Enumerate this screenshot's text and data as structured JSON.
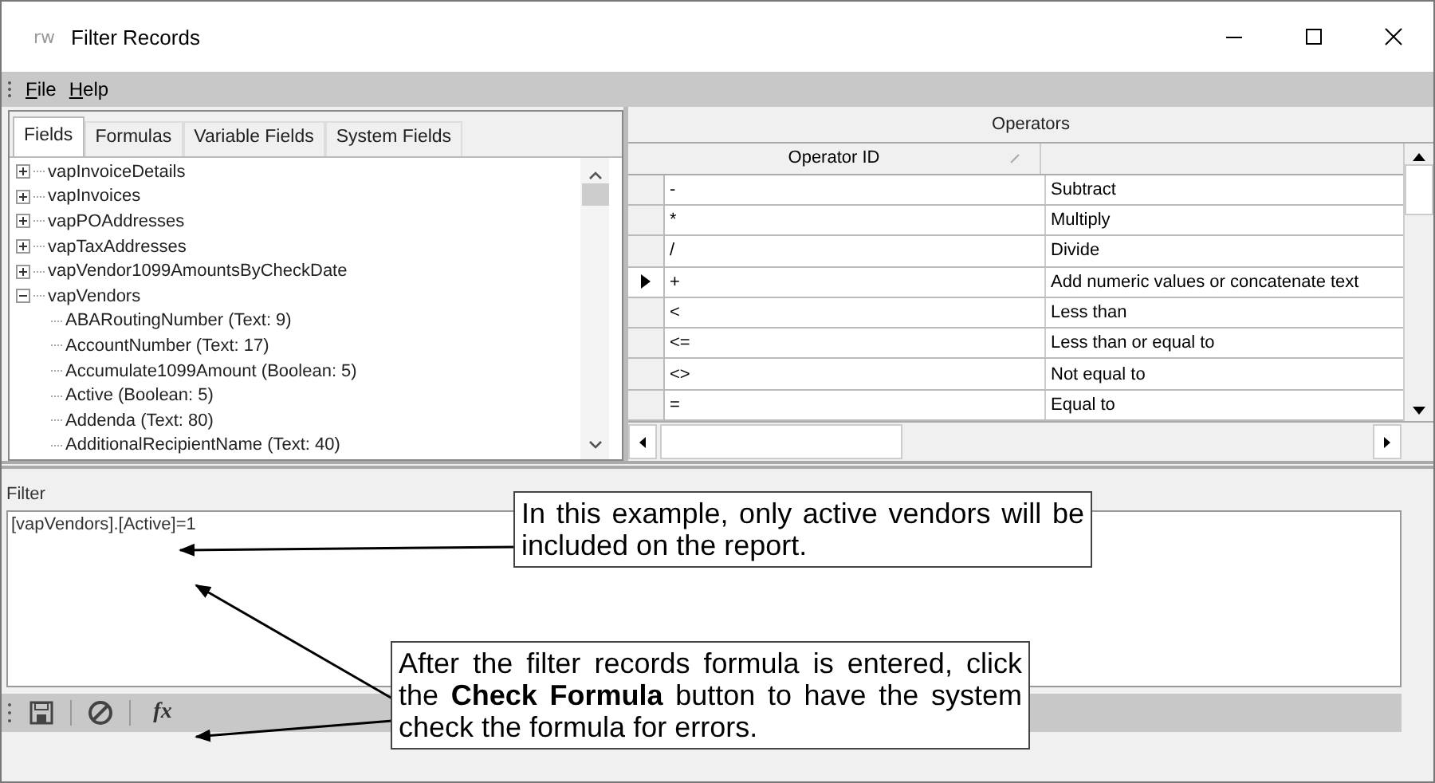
{
  "window": {
    "logo": "rw",
    "title": "Filter Records"
  },
  "menu": [
    {
      "label": "File"
    },
    {
      "label": "Help"
    }
  ],
  "tabs": [
    {
      "label": "Fields",
      "selected": true
    },
    {
      "label": "Formulas",
      "selected": false
    },
    {
      "label": "Variable Fields",
      "selected": false
    },
    {
      "label": "System Fields",
      "selected": false
    }
  ],
  "tree": [
    {
      "label": "vapInvoiceDetails",
      "expanded": false
    },
    {
      "label": "vapInvoices",
      "expanded": false
    },
    {
      "label": "vapPOAddresses",
      "expanded": false
    },
    {
      "label": "vapTaxAddresses",
      "expanded": false
    },
    {
      "label": "vapVendor1099AmountsByCheckDate",
      "expanded": false
    },
    {
      "label": "vapVendors",
      "expanded": true,
      "children": [
        {
          "label": "ABARoutingNumber (Text: 9)"
        },
        {
          "label": "AccountNumber (Text: 17)"
        },
        {
          "label": "Accumulate1099Amount (Boolean: 5)"
        },
        {
          "label": "Active (Boolean: 5)"
        },
        {
          "label": "Addenda (Text: 80)"
        },
        {
          "label": "AdditionalRecipientName (Text: 40)"
        }
      ]
    }
  ],
  "operators": {
    "title": "Operators",
    "columns": [
      "Operator ID"
    ],
    "rows": [
      {
        "id": "-",
        "description": "Subtract",
        "selected": false
      },
      {
        "id": "*",
        "description": "Multiply",
        "selected": false
      },
      {
        "id": "/",
        "description": "Divide",
        "selected": false
      },
      {
        "id": "+",
        "description": "Add numeric values or concatenate text",
        "selected": true
      },
      {
        "id": "<",
        "description": "Less than",
        "selected": false
      },
      {
        "id": "<=",
        "description": "Less than or equal to",
        "selected": false
      },
      {
        "id": "<>",
        "description": "Not equal to",
        "selected": false
      },
      {
        "id": "=",
        "description": "Equal to",
        "selected": false
      }
    ]
  },
  "filter": {
    "label": "Filter",
    "value": "[vapVendors].[Active]=1"
  },
  "toolbar": [
    {
      "kind": "save"
    },
    {
      "kind": "cancel"
    },
    {
      "kind": "formula",
      "glyph": "fx"
    }
  ],
  "callouts": [
    {
      "text": "In this example, only active vendors will be included on the report."
    },
    {
      "text": "After the filter records formula is entered, click the **Check Formula** button to have the system check the formula for errors."
    }
  ]
}
